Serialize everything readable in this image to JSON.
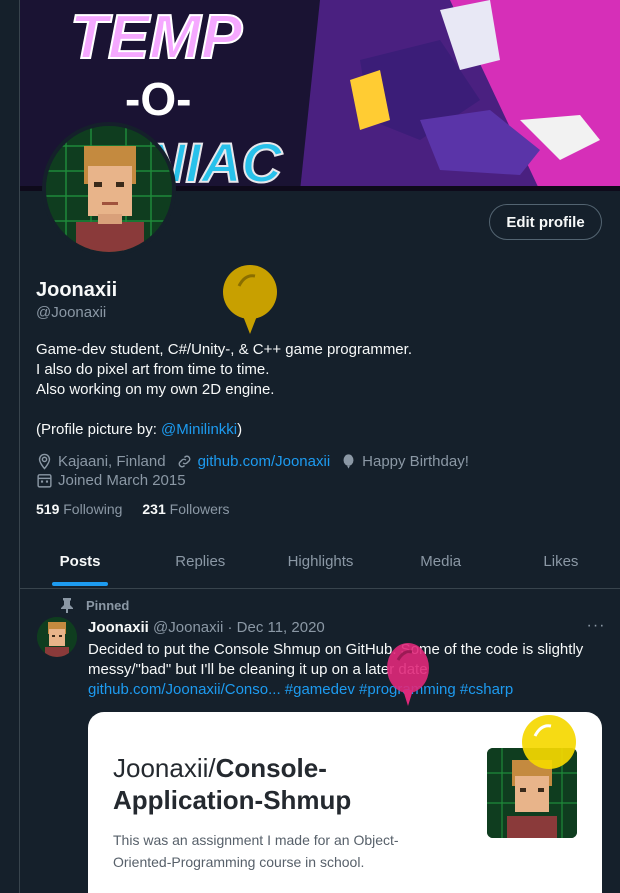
{
  "banner": {
    "game_title_line1": "TEMP",
    "game_title_line2": "-O-",
    "game_title_line3": "MANIAC"
  },
  "profile": {
    "edit_button": "Edit profile",
    "name": "Joonaxii",
    "handle": "@Joonaxii",
    "bio_lines": [
      "Game-dev student, C#/Unity-, & C++ game programmer.",
      "I also do pixel art from time to time.",
      "Also working on my own 2D engine."
    ],
    "credit_prefix": "(Profile picture by: ",
    "credit_link": "@Minilinkki",
    "credit_suffix": ")",
    "location": "Kajaani, Finland",
    "website": "github.com/Joonaxii",
    "birthday": "Happy Birthday!",
    "joined": "Joined March 2015",
    "following_count": "519",
    "following_label": "Following",
    "followers_count": "231",
    "followers_label": "Followers"
  },
  "tabs": [
    {
      "label": "Posts",
      "active": true
    },
    {
      "label": "Replies",
      "active": false
    },
    {
      "label": "Highlights",
      "active": false
    },
    {
      "label": "Media",
      "active": false
    },
    {
      "label": "Likes",
      "active": false
    }
  ],
  "tweet": {
    "pinned_label": "Pinned",
    "author": "Joonaxii",
    "handle": "@Joonaxii",
    "separator": "·",
    "date": "Dec 11, 2020",
    "more": "···",
    "text": "Decided to put the Console Shmup on GitHub. Some of the code is slightly messy/\"bad\" but I'll be cleaning it up on a later date",
    "link": "github.com/Joonaxii/Conso...",
    "hashtags": [
      "#gamedev",
      "#programming",
      "#csharp"
    ],
    "card": {
      "owner": "Joonaxii/",
      "repo": "Console-Application-Shmup",
      "description": "This was an assignment I made for an Object-Oriented-Programming course in school."
    }
  },
  "colors": {
    "background": "#15202b",
    "accent": "#1d9bf0",
    "muted": "#8b98a5",
    "balloon_gold": "#c8a000",
    "balloon_pink": "#e0287a",
    "balloon_yellow": "#f5d800"
  },
  "icons": [
    "location-icon",
    "link-icon",
    "balloon-icon",
    "calendar-icon",
    "pin-icon"
  ]
}
